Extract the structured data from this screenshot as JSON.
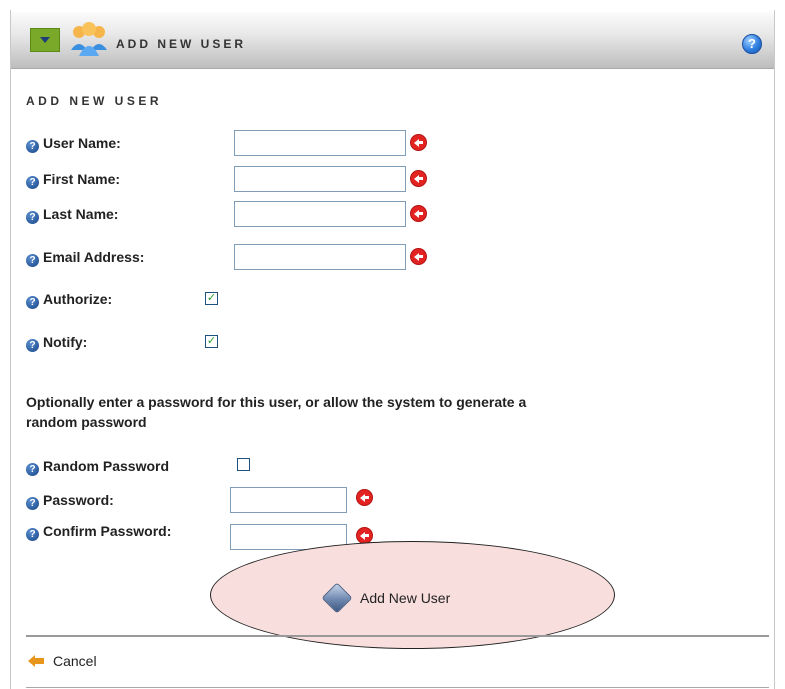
{
  "header": {
    "title": "ADD NEW USER",
    "help_glyph": "?"
  },
  "section": {
    "title": "ADD NEW USER"
  },
  "fields": {
    "username": {
      "label": "User Name:",
      "value": ""
    },
    "firstname": {
      "label": "First Name:",
      "value": ""
    },
    "lastname": {
      "label": "Last Name:",
      "value": ""
    },
    "email": {
      "label": "Email Address:",
      "value": ""
    }
  },
  "options": {
    "authorize": {
      "label": "Authorize:",
      "checked": true
    },
    "notify": {
      "label": "Notify:",
      "checked": true
    }
  },
  "password_note": "Optionally enter a password for this user, or allow the system to generate a random password",
  "password": {
    "random": {
      "label": "Random Password",
      "checked": false
    },
    "password": {
      "label": "Password:",
      "value": ""
    },
    "confirm": {
      "label": "Confirm Password:",
      "value": ""
    }
  },
  "actions": {
    "add_label": "Add New User",
    "cancel_label": "Cancel"
  },
  "icons": {
    "help": "help-icon",
    "users": "users-icon",
    "required": "required-arrow-icon",
    "question": "question-icon",
    "add": "add-user-icon",
    "cancel": "back-arrow-icon"
  },
  "colors": {
    "accent_green": "#7aa92a",
    "required_red": "#e32222",
    "highlight_pink": "#f8dedd",
    "check_green": "#2a9a2a"
  }
}
